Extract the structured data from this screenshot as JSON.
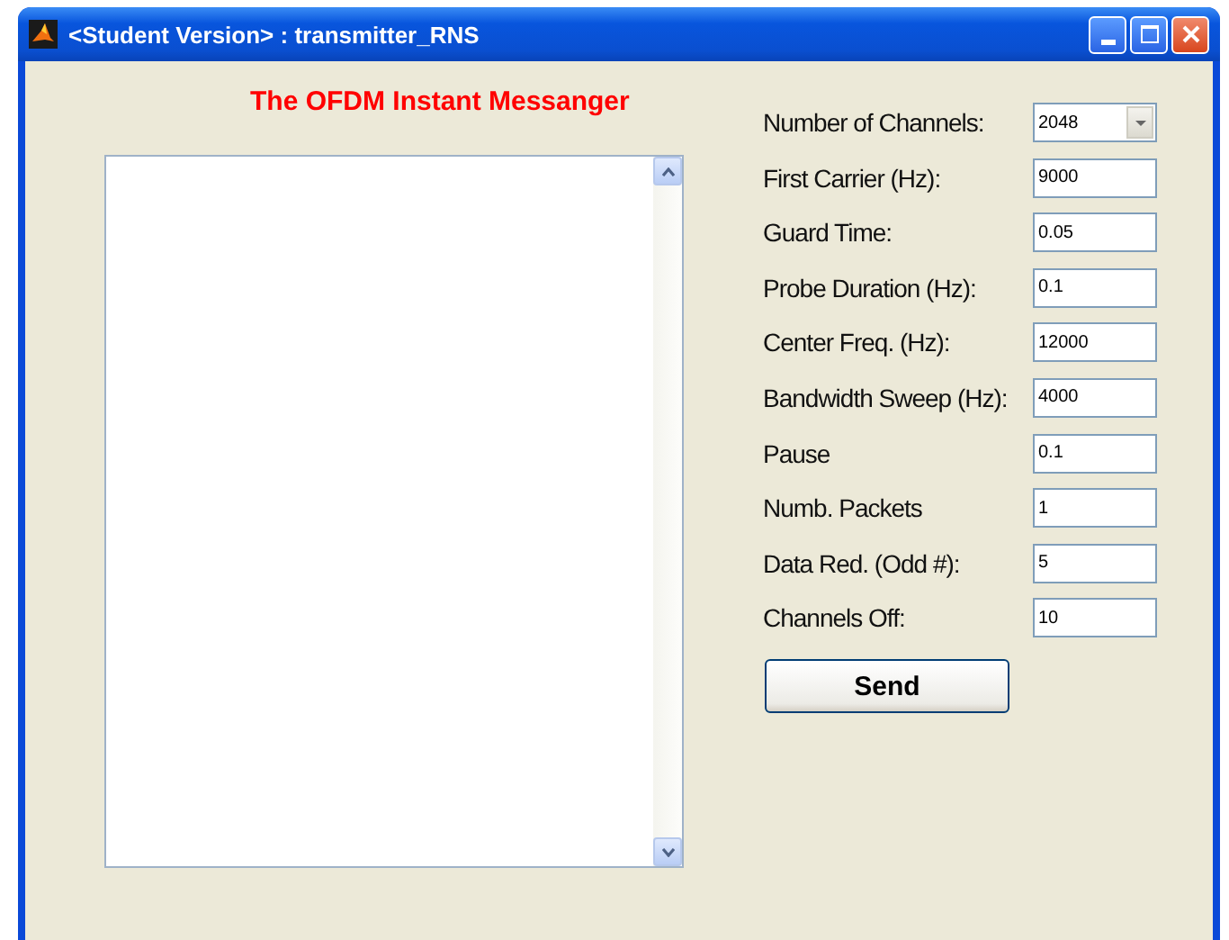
{
  "window": {
    "title": "<Student Version> : transmitter_RNS"
  },
  "heading": "The OFDM Instant Messanger",
  "settings": [
    {
      "label": "Number of Channels:",
      "value": "2048",
      "kind": "dropdown"
    },
    {
      "label": "First Carrier (Hz):",
      "value": "9000",
      "kind": "field"
    },
    {
      "label": "Guard Time:",
      "value": "0.05",
      "kind": "field"
    },
    {
      "label": "Probe Duration (Hz):",
      "value": "0.1",
      "kind": "field"
    },
    {
      "label": "Center Freq. (Hz):",
      "value": "12000",
      "kind": "field"
    },
    {
      "label": "Bandwidth Sweep (Hz):",
      "value": "4000",
      "kind": "field"
    },
    {
      "label": "Pause",
      "value": "0.1",
      "kind": "field"
    },
    {
      "label": "Numb. Packets",
      "value": "1",
      "kind": "field"
    },
    {
      "label": "Data Red. (Odd #):",
      "value": "5",
      "kind": "field"
    },
    {
      "label": "Channels Off:",
      "value": "10",
      "kind": "field"
    }
  ],
  "send_button": "Send"
}
